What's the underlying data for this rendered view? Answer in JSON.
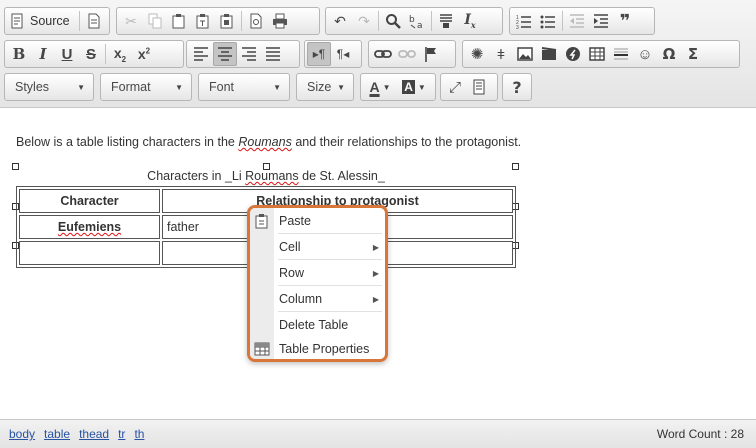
{
  "toolbar": {
    "source_label": "Source",
    "styles_label": "Styles",
    "format_label": "Format",
    "font_label": "Font",
    "size_label": "Size",
    "bold_glyph": "B",
    "italic_glyph": "I",
    "underline_glyph": "U",
    "strike_glyph": "S",
    "omega_glyph": "Ω",
    "sigma_glyph": "Σ",
    "help_glyph": "?",
    "quote_glyph": "❞"
  },
  "content": {
    "intro_before": "Below is a table listing characters in the ",
    "intro_italic": "Roumans",
    "intro_after": " and their relationships to the protagonist.",
    "caption_before": "Characters in _Li ",
    "caption_spell": "Roumans",
    "caption_after": " de St. Alessin_",
    "table": {
      "headers": [
        "Character",
        "Relationship to protagonist"
      ],
      "rows": [
        [
          "Eufemiens",
          "father"
        ],
        [
          "",
          ""
        ]
      ]
    }
  },
  "context_menu": {
    "items": [
      {
        "label": "Paste",
        "icon": "paste-icon"
      },
      {
        "label": "Cell",
        "submenu": true
      },
      {
        "label": "Row",
        "submenu": true
      },
      {
        "label": "Column",
        "submenu": true
      },
      {
        "label": "Delete Table"
      },
      {
        "label": "Table Properties",
        "icon": "table-icon"
      }
    ],
    "submenu_arrow": "▶"
  },
  "statusbar": {
    "breadcrumbs": [
      "body",
      "table",
      "thead",
      "tr",
      "th"
    ],
    "word_count": "Word Count : 28"
  },
  "colors": {
    "context_border": "#d8763a",
    "link": "#2952a3",
    "spell_underline": "#dd1111"
  }
}
